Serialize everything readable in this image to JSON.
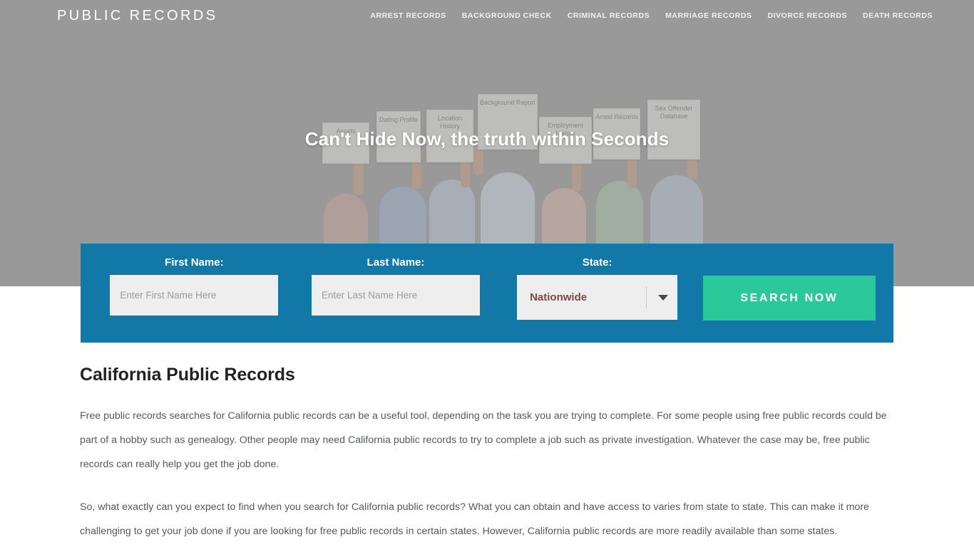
{
  "header": {
    "brand": "PUBLIC RECORDS",
    "nav": [
      {
        "label": "ARREST RECORDS"
      },
      {
        "label": "BACKGROUND CHECK"
      },
      {
        "label": "CRIMINAL RECORDS"
      },
      {
        "label": "MARRIAGE RECORDS"
      },
      {
        "label": "DIVORCE RECORDS"
      },
      {
        "label": "DEATH RECORDS"
      }
    ]
  },
  "hero": {
    "heading": "Can't Hide Now, the truth within Seconds",
    "photo_signs": [
      "Assets",
      "Dating Profile",
      "Location History",
      "Background Report",
      "Employment History",
      "Arrest Records",
      "Sex Offender Database"
    ]
  },
  "search_form": {
    "first_name": {
      "label": "First Name:",
      "placeholder": "Enter First Name Here",
      "value": ""
    },
    "last_name": {
      "label": "Last Name:",
      "placeholder": "Enter Last Name Here",
      "value": ""
    },
    "state": {
      "label": "State:",
      "selected": "Nationwide"
    },
    "submit_label": "SEARCH NOW"
  },
  "article": {
    "title": "California Public Records",
    "paragraphs": [
      "Free public records searches for California public records can be a useful tool, depending on the task you are trying to complete. For some people using free public records could be part of a hobby such as genealogy. Other people may need California public records to try to complete a job such as private investigation. Whatever the case may be, free public records can really help you get the job done.",
      "So, what exactly can you expect to find when you search for California public records? What you can obtain and have access to varies from state to state. This can make it more challenging to get your job done if you are looking for free public records in certain states. However, California public records are more readily available than some states."
    ]
  },
  "colors": {
    "hero_background": "#999999",
    "form_panel": "#1178a8",
    "submit_button": "#2bc89a",
    "select_text": "#7a4747"
  }
}
